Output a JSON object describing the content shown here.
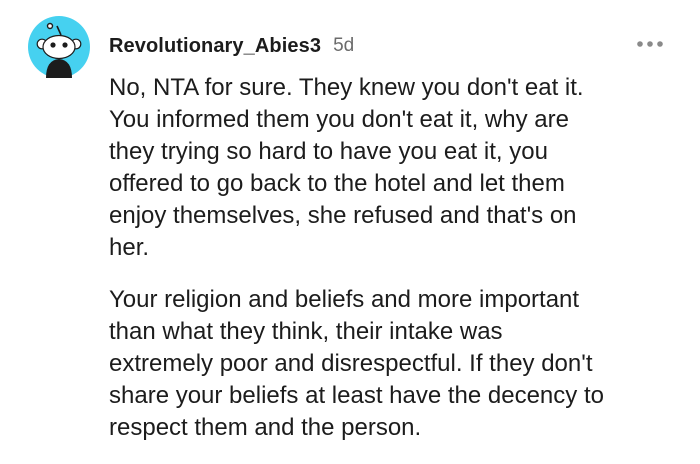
{
  "comment": {
    "author": "Revolutionary_Abies3",
    "timestamp": "5d",
    "avatar_icon": "reddit-snoo-avatar",
    "avatar_color": "#46d1f0",
    "more_icon": "more-horizontal-icon",
    "paragraphs": [
      "No, NTA for sure. They knew you don't eat it.\nYou informed them you don't eat it, why are\nthey trying so hard to have you eat it, you\noffered to go back to the hotel and let them\nenjoy themselves, she refused and that's on\nher.",
      "Your religion and beliefs and more important\nthan what they think, their intake was\nextremely poor and disrespectful. If they don't\nshare your beliefs at least have the decency to\nrespect them and the person."
    ]
  }
}
